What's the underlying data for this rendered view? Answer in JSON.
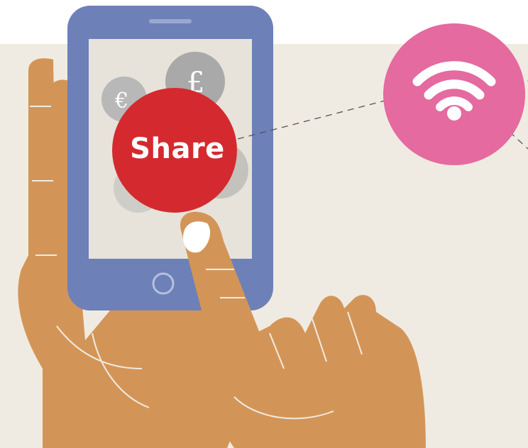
{
  "illustration": {
    "share_button_label": "Share",
    "icons": [
      "wifi-icon",
      "euro-coin-icon",
      "pound-coin-icon",
      "home-button-icon"
    ],
    "colors": {
      "background": "#efebe2",
      "phone_body": "#6e80b8",
      "phone_screen": "#e7e3da",
      "share_button": "#d42a2f",
      "wifi_circle": "#e46a9f",
      "hand": "#d39557",
      "hand_lines": "#efebe2"
    }
  }
}
